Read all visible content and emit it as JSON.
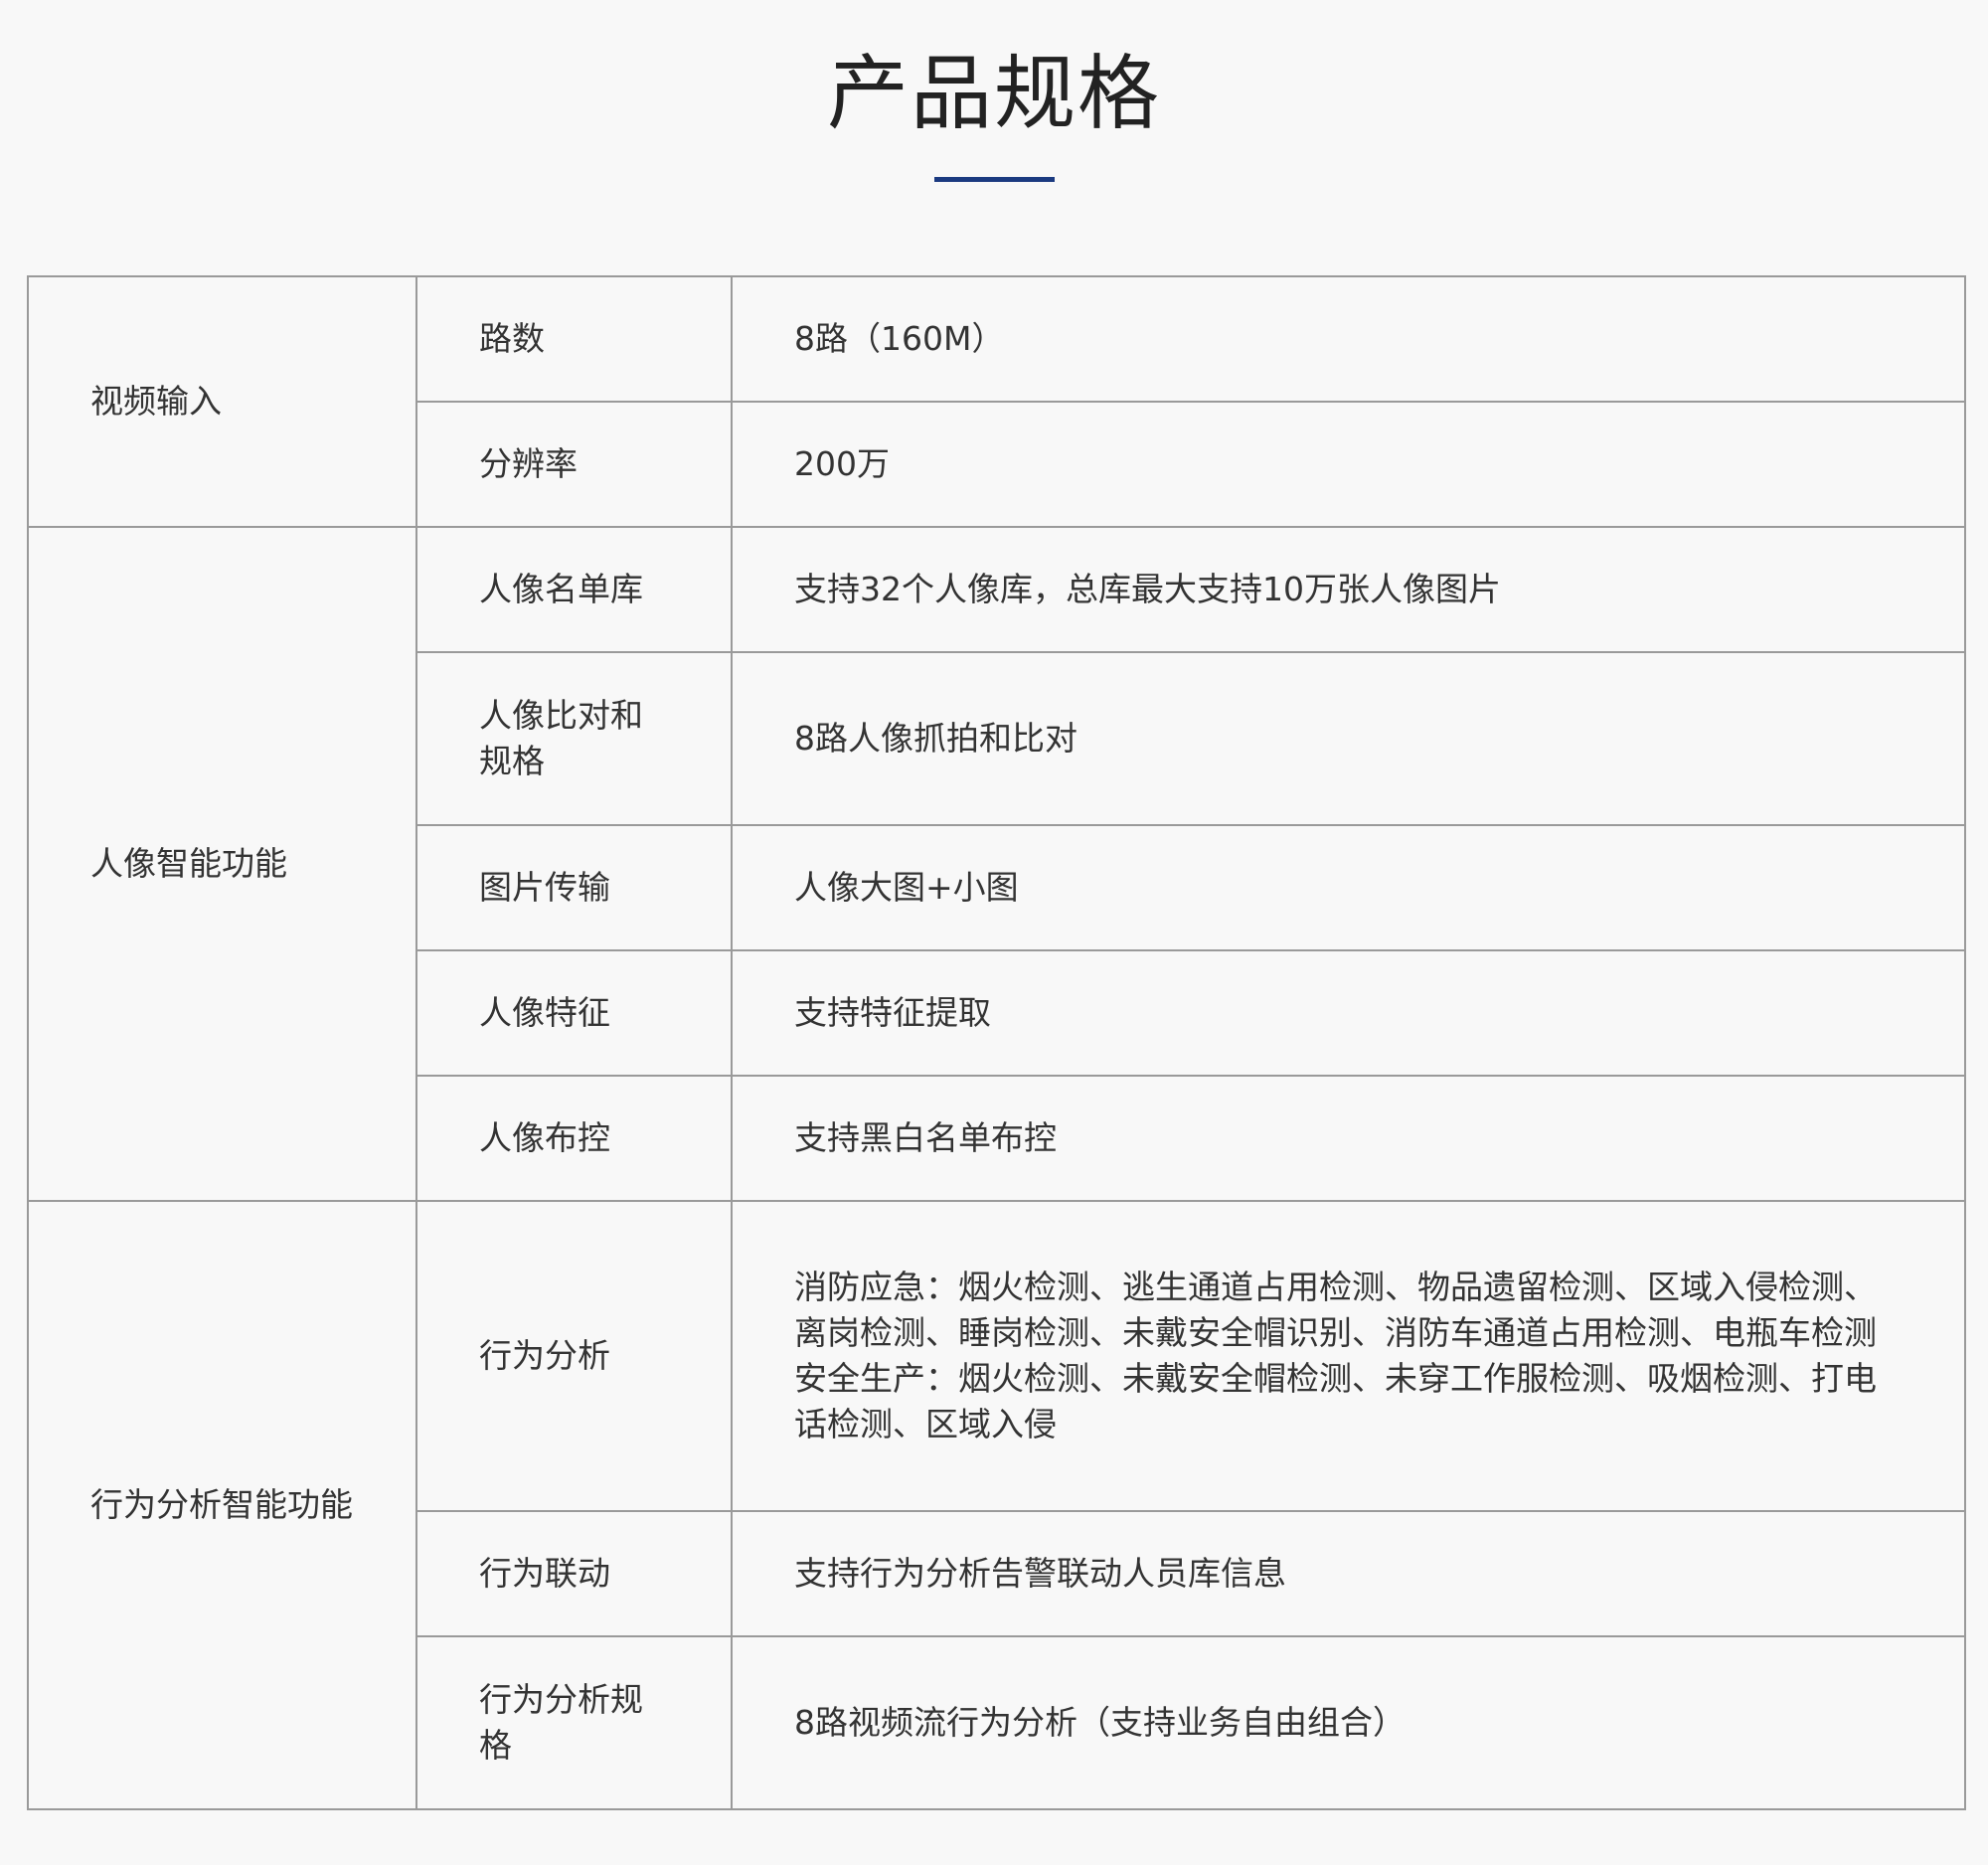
{
  "title": "产品规格",
  "accent_color": "#1b3a80",
  "border_color": "#9a9a9a",
  "table": {
    "groups": [
      {
        "category": "视频输入",
        "rows": [
          {
            "item": "路数",
            "value": [
              "8路（160M）"
            ]
          },
          {
            "item": "分辨率",
            "value": [
              "200万"
            ]
          }
        ]
      },
      {
        "category": "人像智能功能",
        "rows": [
          {
            "item": "人像名单库",
            "value": [
              "支持32个人像库，总库最大支持10万张人像图片"
            ]
          },
          {
            "item": "人像比对和规格",
            "value": [
              "8路人像抓拍和比对"
            ]
          },
          {
            "item": "图片传输",
            "value": [
              "人像大图+小图"
            ]
          },
          {
            "item": "人像特征",
            "value": [
              "支持特征提取"
            ]
          },
          {
            "item": "人像布控",
            "value": [
              "支持黑白名单布控"
            ]
          }
        ]
      },
      {
        "category": "行为分析智能功能",
        "rows": [
          {
            "item": "行为分析",
            "value": [
              "消防应急：烟火检测、逃生通道占用检测、物品遗留检测、区域入侵检测、离岗检测、睡岗检测、未戴安全帽识别、消防车通道占用检测、电瓶车检测",
              "安全生产：烟火检测、未戴安全帽检测、未穿工作服检测、吸烟检测、打电话检测、区域入侵"
            ]
          },
          {
            "item": "行为联动",
            "value": [
              "支持行为分析告警联动人员库信息"
            ]
          },
          {
            "item": "行为分析规格",
            "value": [
              "8路视频流行为分析（支持业务自由组合）"
            ]
          }
        ]
      }
    ]
  }
}
